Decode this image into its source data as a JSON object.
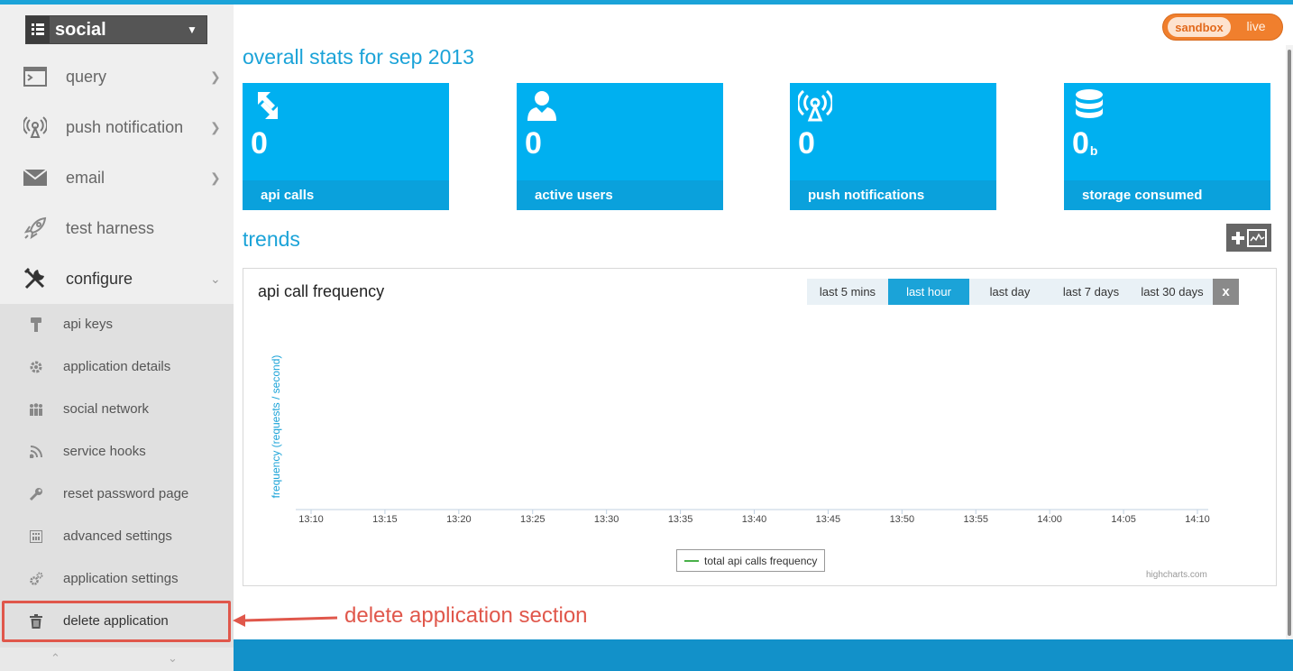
{
  "app_selector": {
    "name": "social",
    "grid_icon": "grid-icon",
    "caret_icon": "chevron-down-icon"
  },
  "nav": [
    {
      "id": "query",
      "label": "query",
      "icon": "terminal-icon",
      "chevron": "›"
    },
    {
      "id": "push-notification",
      "label": "push notification",
      "icon": "broadcast-icon",
      "chevron": "›"
    },
    {
      "id": "email",
      "label": "email",
      "icon": "envelope-icon",
      "chevron": "›"
    },
    {
      "id": "test-harness",
      "label": "test harness",
      "icon": "rocket-icon",
      "chevron": ""
    },
    {
      "id": "configure",
      "label": "configure",
      "icon": "tools-icon",
      "chevron": "⌄"
    }
  ],
  "configure_items": [
    {
      "label": "api keys",
      "icon": "key-icon"
    },
    {
      "label": "application details",
      "icon": "gear-icon"
    },
    {
      "label": "social network",
      "icon": "people-icon"
    },
    {
      "label": "service hooks",
      "icon": "rss-icon"
    },
    {
      "label": "reset password page",
      "icon": "wrench-icon"
    },
    {
      "label": "advanced settings",
      "icon": "calculator-icon"
    },
    {
      "label": "application settings",
      "icon": "gears-icon"
    },
    {
      "label": "delete application",
      "icon": "trash-icon"
    }
  ],
  "sidebar_footer": {
    "up": "⌃",
    "down": "⌄"
  },
  "environment": {
    "sandbox": "sandbox",
    "live": "live",
    "active": "sandbox"
  },
  "overview": {
    "title": "overall stats for sep 2013",
    "stats": [
      {
        "value": "0",
        "unit": "",
        "label": "api calls",
        "icon": "arrows-icon"
      },
      {
        "value": "0",
        "unit": "",
        "label": "active users",
        "icon": "user-icon"
      },
      {
        "value": "0",
        "unit": "",
        "label": "push notifications",
        "icon": "broadcast-icon"
      },
      {
        "value": "0",
        "unit": "b",
        "label": "storage consumed",
        "icon": "database-icon"
      }
    ]
  },
  "trends": {
    "title": "trends",
    "add_chart_icon": "add-chart-icon"
  },
  "chart": {
    "title": "api call frequency",
    "ranges": [
      "last 5 mins",
      "last hour",
      "last day",
      "last 7 days",
      "last 30 days"
    ],
    "active_range": "last hour",
    "close_label": "x",
    "legend": "total api calls frequency",
    "credit": "highcharts.com",
    "series_color": "#49b049",
    "axis_color": "#1ba3d8"
  },
  "chart_data": {
    "type": "line",
    "title": "api call frequency",
    "xlabel": "",
    "ylabel": "frequency (requests / second)",
    "x_ticks": [
      "13:10",
      "13:15",
      "13:20",
      "13:25",
      "13:30",
      "13:35",
      "13:40",
      "13:45",
      "13:50",
      "13:55",
      "14:00",
      "14:05",
      "14:10"
    ],
    "series": [
      {
        "name": "total api calls frequency",
        "values": []
      }
    ],
    "grid": false,
    "legend_position": "bottom-center"
  },
  "annotation": {
    "text": "delete application section",
    "color": "#e0574b"
  },
  "colors": {
    "accent": "#1ba3d8",
    "tile": "#00b0f0",
    "tile_footer": "#0aa1dc",
    "toggle": "#f07f2d",
    "highlight": "#e0574b"
  }
}
